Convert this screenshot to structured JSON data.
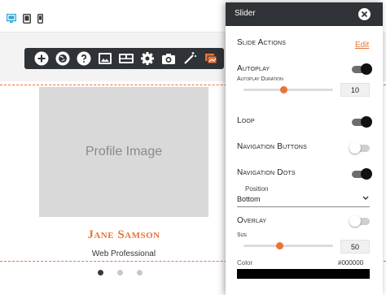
{
  "device_bar": {
    "icons": [
      "desktop-icon",
      "tablet-icon",
      "mobile-icon"
    ],
    "active_color": "#2aa6d6"
  },
  "toolbar": {
    "icons": [
      "add-icon",
      "globe-icon",
      "help-icon",
      "image-icon",
      "layout-icon",
      "gear-icon",
      "camera-icon",
      "magic-wand-icon",
      "slider-icon"
    ],
    "background": "#2f3337",
    "active_color": "#e8743b"
  },
  "slide": {
    "image_placeholder": "Profile Image",
    "name": "Jane Samson",
    "role": "Web Professional",
    "dots": 3,
    "active_dot": 1,
    "accent": "#e8743b"
  },
  "panel": {
    "title": "Slider",
    "slide_actions_label": "Slide Actions",
    "edit_label": "Edit",
    "autoplay": {
      "label": "Autoplay",
      "on": true
    },
    "autoplay_duration": {
      "label": "Autoplay Duration",
      "value": "10",
      "fraction": 0.45
    },
    "loop": {
      "label": "Loop",
      "on": true
    },
    "navigation_buttons": {
      "label": "Navigation Buttons",
      "on": false
    },
    "navigation_dots": {
      "label": "Navigation Dots",
      "on": true
    },
    "position": {
      "caption": "Position",
      "value": "Bottom"
    },
    "overlay": {
      "label": "Overlay",
      "on": false
    },
    "size": {
      "label": "Size",
      "value": "50",
      "fraction": 0.4
    },
    "color": {
      "label": "Color",
      "value": "#000000"
    }
  }
}
